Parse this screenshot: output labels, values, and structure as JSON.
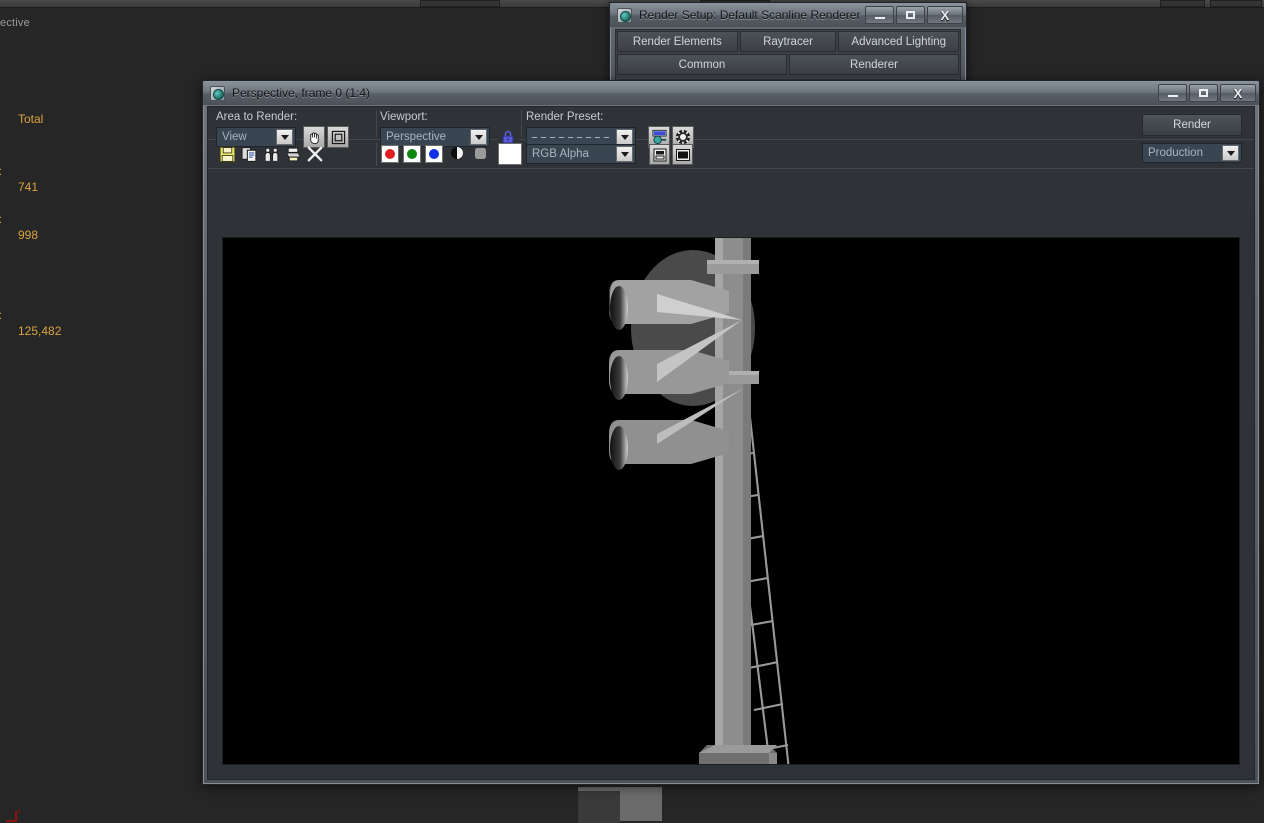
{
  "app": {
    "background_viewport_label": "ective",
    "statistics": {
      "header": "Total",
      "rows": [
        {
          "label": "s:",
          "value": "741"
        },
        {
          "label": "s:",
          "value": "998"
        },
        {
          "label": ":",
          "value": "125,482"
        }
      ]
    }
  },
  "render_setup": {
    "title": "Render Setup: Default Scanline Renderer",
    "icon": "max-app-icon",
    "window_buttons": {
      "minimize": "minimize-icon",
      "maximize": "maximize-icon",
      "close": "X"
    },
    "tabs_row1": [
      "Render Elements",
      "Raytracer",
      "Advanced Lighting"
    ],
    "tabs_row2": [
      "Common",
      "Renderer"
    ]
  },
  "rendered_frame_window": {
    "title": "Perspective, frame 0 (1:4)",
    "icon": "max-app-icon",
    "window_buttons": {
      "minimize": "minimize-icon",
      "maximize": "maximize-icon",
      "close": "X"
    },
    "labels": {
      "area_to_render": "Area to Render:",
      "viewport": "Viewport:",
      "render_preset": "Render Preset:"
    },
    "area_to_render_value": "View",
    "viewport_value": "Perspective",
    "render_preset_value": "",
    "channel_value": "RGB Alpha",
    "render_button": "Render",
    "production_value": "Production",
    "toolbar_icons": [
      "save-bitmap-icon",
      "copy-bitmap-icon",
      "clone-bitmap-icon",
      "print-bitmap-icon",
      "clear-bitmap-icon"
    ],
    "area_icons": [
      "pan-hand-icon",
      "region-frame-icon"
    ],
    "preset_icons": [
      "render-setup-icon",
      "env-effects-icon"
    ],
    "viewport_lock_icon": "lock-icon",
    "channel_buttons": [
      {
        "name": "red-channel-button",
        "color": "#e02020"
      },
      {
        "name": "green-channel-button",
        "color": "#108810"
      },
      {
        "name": "blue-channel-button",
        "color": "#1030e8"
      },
      {
        "name": "alpha-channel-button",
        "color": "#ffffff"
      },
      {
        "name": "mono-channel-button",
        "color": "#9a9a9a"
      }
    ],
    "color_swatch": "#ffffff",
    "display_icons": [
      "duplicate-window-icon",
      "toggle-ui-icon"
    ]
  },
  "colors": {
    "accent_stats": "#d9a441",
    "dialog_face": "#3b4046",
    "combo_face": "#3a4552",
    "render_bg": "#000000"
  },
  "render_scene": {
    "description": "Grayscale clay render of a traffic signal head mounted on a tall pole with a service ladder",
    "objects": [
      "traffic-light-backplate",
      "lamp-hood-top",
      "lamp-hood-middle",
      "lamp-hood-bottom",
      "pole",
      "pole-collar-upper",
      "pole-collar-lower",
      "ladder",
      "pole-base"
    ],
    "background": "#000000"
  }
}
